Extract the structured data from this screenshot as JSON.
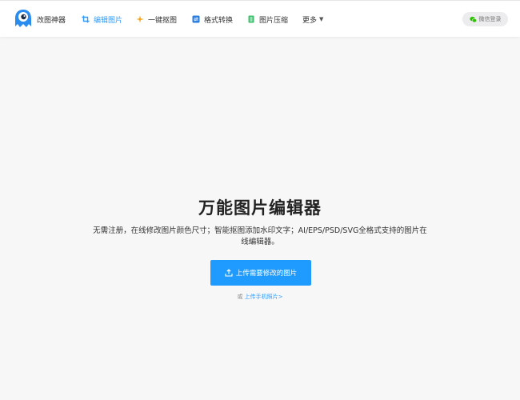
{
  "header": {
    "logo_text": "改图神器",
    "nav": [
      {
        "label": "编辑图片",
        "icon": "crop-icon",
        "active": true
      },
      {
        "label": "一键抠图",
        "icon": "sparkle-icon",
        "active": false
      },
      {
        "label": "格式转换",
        "icon": "convert-icon",
        "active": false
      },
      {
        "label": "图片压缩",
        "icon": "compress-icon",
        "active": false
      },
      {
        "label": "更多",
        "icon": "caret-down-icon",
        "active": false
      }
    ],
    "login_label": "微信登录"
  },
  "hero": {
    "title": "万能图片编辑器",
    "description": "无需注册，在线修改图片颜色尺寸；智能抠图添加水印文字；AI/EPS/PSD/SVG全格式支持的图片在线编辑器。",
    "upload_label": "上传需要修改的图片",
    "alt_prefix": "或",
    "alt_link": "上传手机照片>"
  },
  "colors": {
    "accent": "#1f9bff",
    "background": "#f7f7f8",
    "logo_blue": "#2b8cf0"
  }
}
